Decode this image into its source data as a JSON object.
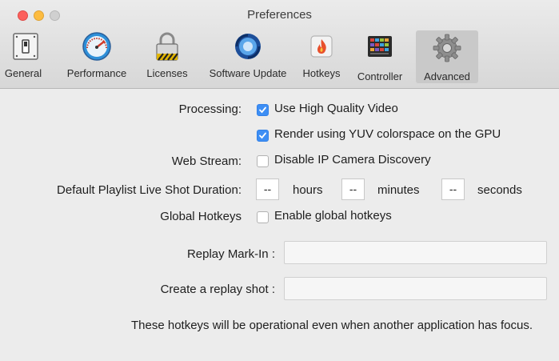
{
  "window": {
    "title": "Preferences"
  },
  "toolbar": {
    "tabs": [
      {
        "label": "General",
        "icon": "switch-icon"
      },
      {
        "label": "Performance",
        "icon": "speedometer-icon"
      },
      {
        "label": "Licenses",
        "icon": "padlock-icon"
      },
      {
        "label": "Software Update",
        "icon": "refresh-icon"
      },
      {
        "label": "Hotkeys",
        "icon": "flame-icon"
      },
      {
        "label": "Controller",
        "icon": "controller-icon"
      },
      {
        "label": "Advanced",
        "icon": "gear-icon"
      }
    ],
    "active": "Advanced"
  },
  "processing": {
    "label": "Processing:",
    "high_quality": {
      "label": "Use High Quality Video",
      "checked": true
    },
    "yuv": {
      "label": "Render using YUV colorspace on the GPU",
      "checked": true
    }
  },
  "web_stream": {
    "label": "Web Stream:",
    "disable_ip_camera": {
      "label": "Disable IP Camera Discovery",
      "checked": false
    }
  },
  "playlist": {
    "label": "Default Playlist Live Shot Duration:",
    "hours_value": "--",
    "hours_unit": "hours",
    "minutes_value": "--",
    "minutes_unit": "minutes",
    "seconds_value": "--",
    "seconds_unit": "seconds"
  },
  "global_hotkeys": {
    "label": "Global Hotkeys",
    "enable": {
      "label": "Enable global hotkeys",
      "checked": false
    }
  },
  "replay_mark_in": {
    "label": "Replay Mark-In :",
    "value": ""
  },
  "create_replay": {
    "label": "Create a replay shot :",
    "value": ""
  },
  "note": "These hotkeys will be operational even when another application has focus.",
  "colors": {
    "accent": "#3d8ef4",
    "close": "#fc605c",
    "minimize": "#fdbc40"
  }
}
